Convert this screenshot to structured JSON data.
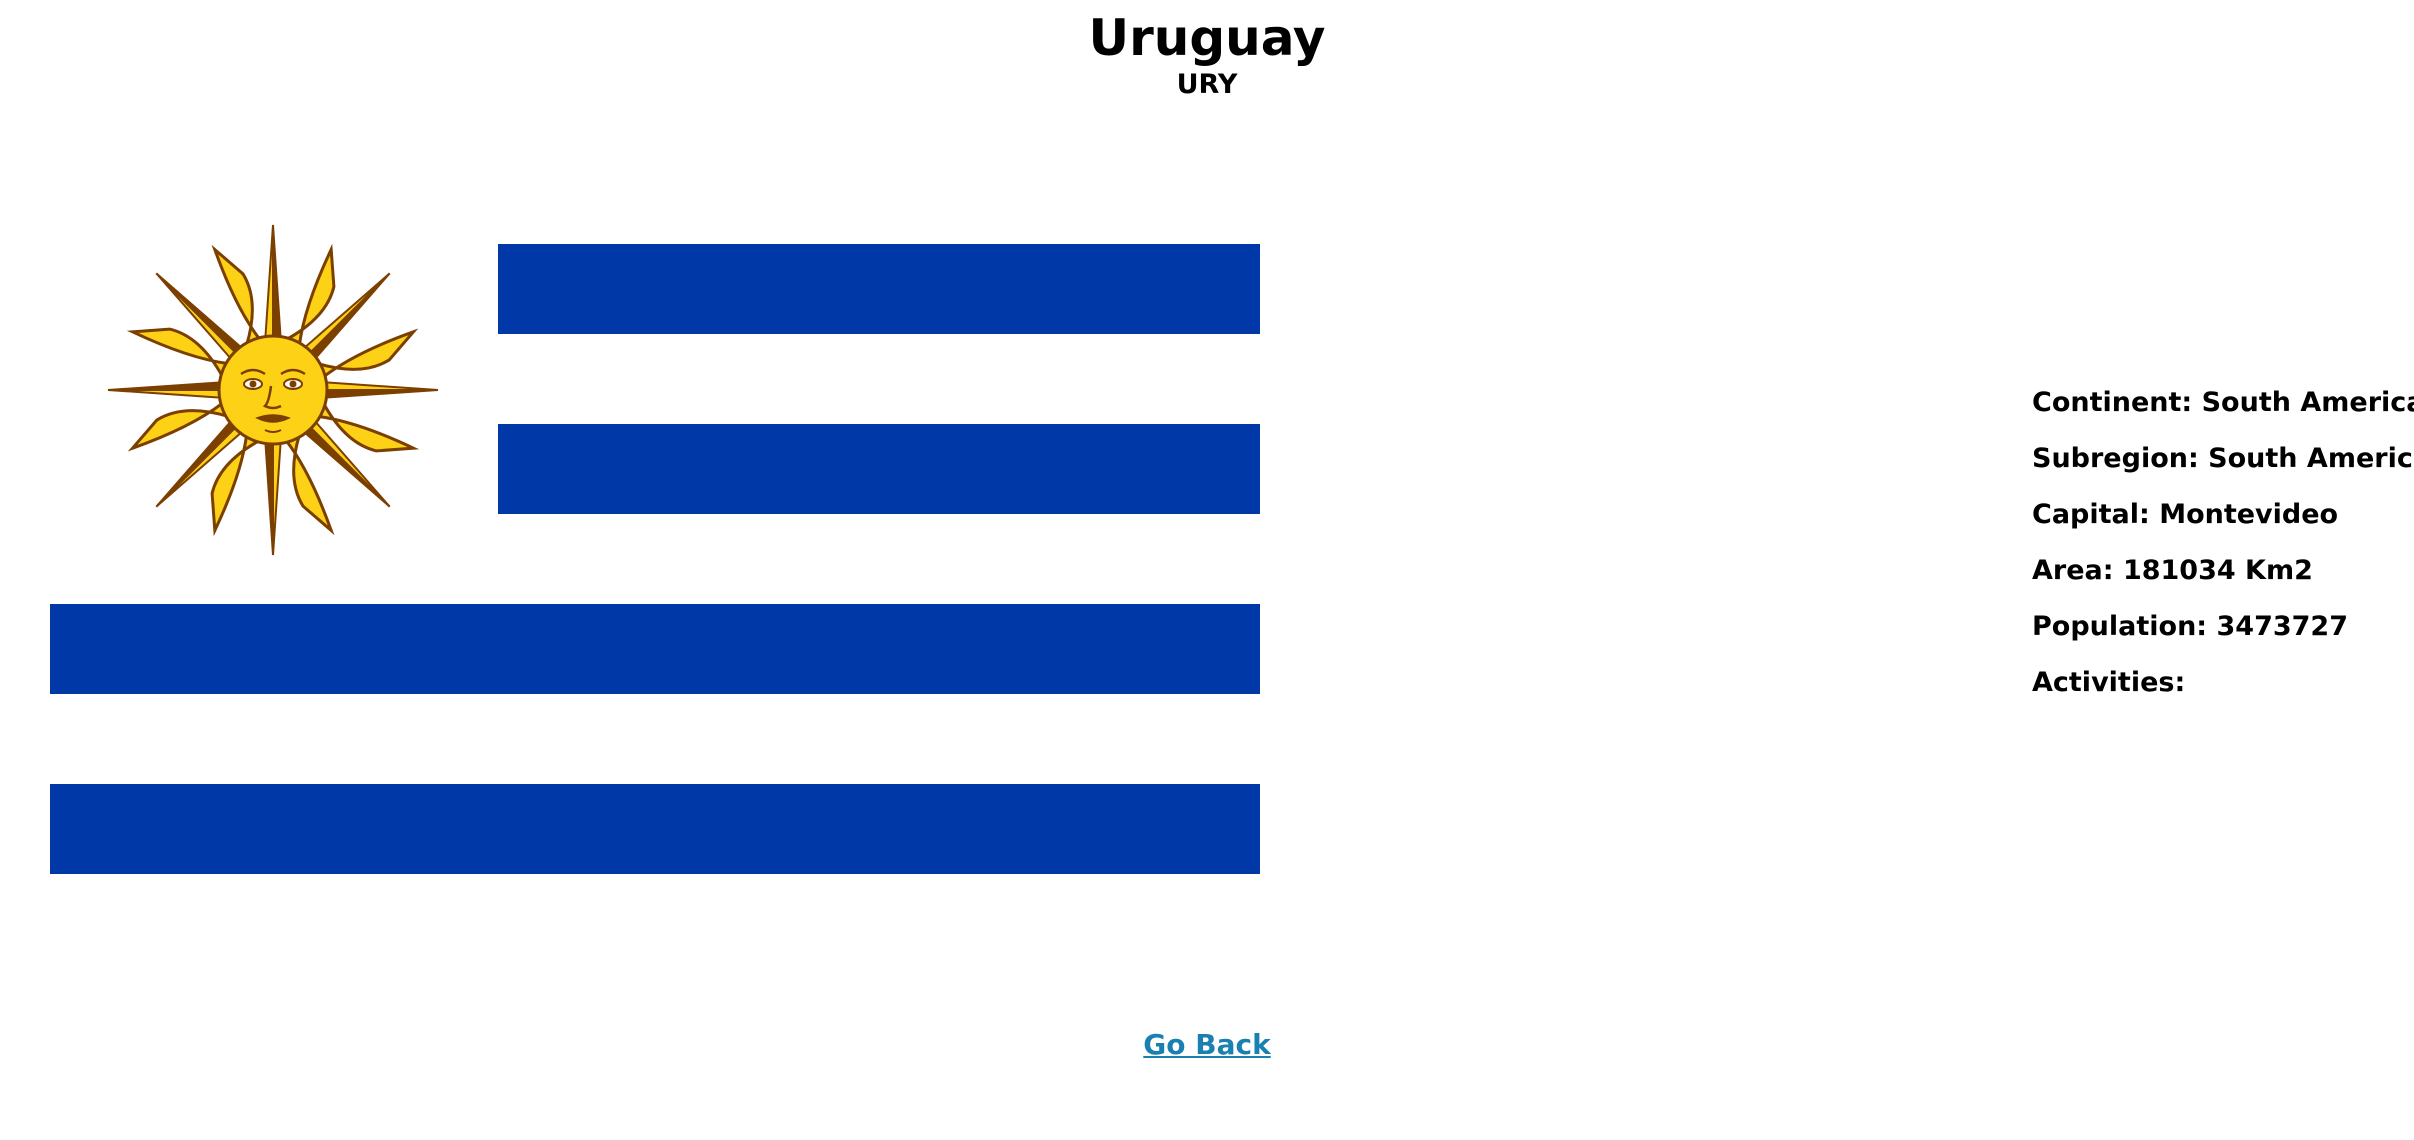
{
  "country": {
    "name": "Uruguay",
    "code": "URY"
  },
  "flag": {
    "icon": "uruguay-flag",
    "colors": {
      "blue": "#0038a8",
      "white": "#ffffff",
      "sun_fill": "#fcd116",
      "sun_stroke": "#7b3f00"
    }
  },
  "info": {
    "continent": "Continent: South America",
    "subregion": "Subregion: South America",
    "capital": "Capital: Montevideo",
    "area": "Area: 181034 Km2",
    "population": "Population: 3473727",
    "activities": "Activities:"
  },
  "nav": {
    "go_back": "Go Back",
    "link_color": "#1a7fb1"
  }
}
